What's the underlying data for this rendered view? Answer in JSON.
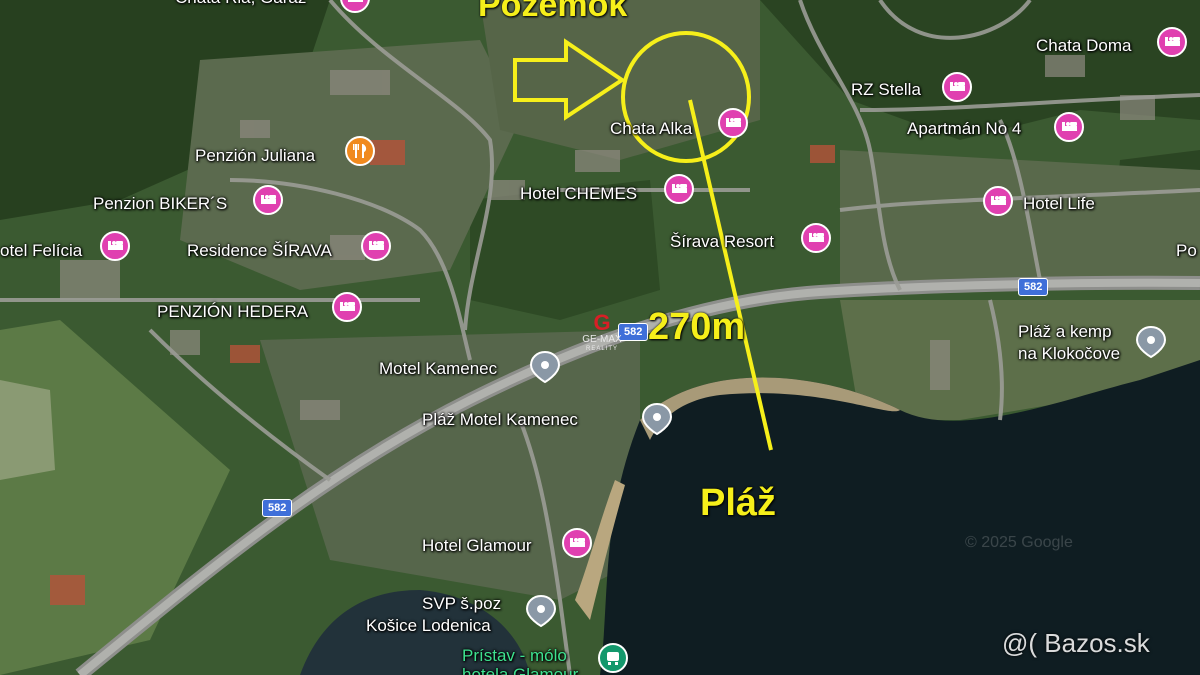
{
  "map": {
    "annotations": {
      "plot_label": "Pozemok",
      "distance_label": "270m",
      "beach_label": "Pláž"
    },
    "places": [
      {
        "name": "Chata Ria, Garáž",
        "type": "hotel"
      },
      {
        "name": "Chata Doma",
        "type": "hotel"
      },
      {
        "name": "RZ Stella",
        "type": "hotel"
      },
      {
        "name": "Apartmán No 4",
        "type": "hotel"
      },
      {
        "name": "Chata Alka",
        "type": "hotel"
      },
      {
        "name": "Penzión Juliana",
        "type": "restaurant"
      },
      {
        "name": "Hotel CHEMES",
        "type": "hotel"
      },
      {
        "name": "Hotel Life",
        "type": "hotel"
      },
      {
        "name": "Penzion BIKER´S",
        "type": "hotel"
      },
      {
        "name": "Šírava Resort",
        "type": "hotel"
      },
      {
        "name": "otel Felícia",
        "type": "hotel"
      },
      {
        "name": "Residence ŠÍRAVA",
        "type": "hotel"
      },
      {
        "name": "Po",
        "type": "label"
      },
      {
        "name": "PENZIÓN HEDERA",
        "type": "hotel"
      },
      {
        "name": "Pláž a kemp",
        "type": "place"
      },
      {
        "name": "na Klokočove",
        "type": "place"
      },
      {
        "name": "Motel Kamenec",
        "type": "place"
      },
      {
        "name": "Pláž Motel Kamenec",
        "type": "place"
      },
      {
        "name": "Hotel Glamour",
        "type": "hotel"
      },
      {
        "name": "SVP š.poz",
        "type": "place"
      },
      {
        "name": "Košice Lodenica",
        "type": "place"
      },
      {
        "name": "Prístav - mólo",
        "type": "transit"
      },
      {
        "name": "hotela Glamour",
        "type": "transit"
      }
    ],
    "roads": [
      "582",
      "582",
      "582"
    ],
    "logo": {
      "letter": "G",
      "name": "GE-MAX",
      "sub": "REALITY"
    },
    "copyright": "© 2025 Google",
    "watermark": "@( Bazos.sk"
  },
  "colors": {
    "annotation": "#f6ef1a",
    "hotel_pin": "#e040b0",
    "restaurant_pin": "#f08a1e",
    "place_pin": "#8a98a6",
    "transit_pin": "#13986c",
    "lake": "#0f1d22",
    "road_shield": "#3f6fd9"
  }
}
